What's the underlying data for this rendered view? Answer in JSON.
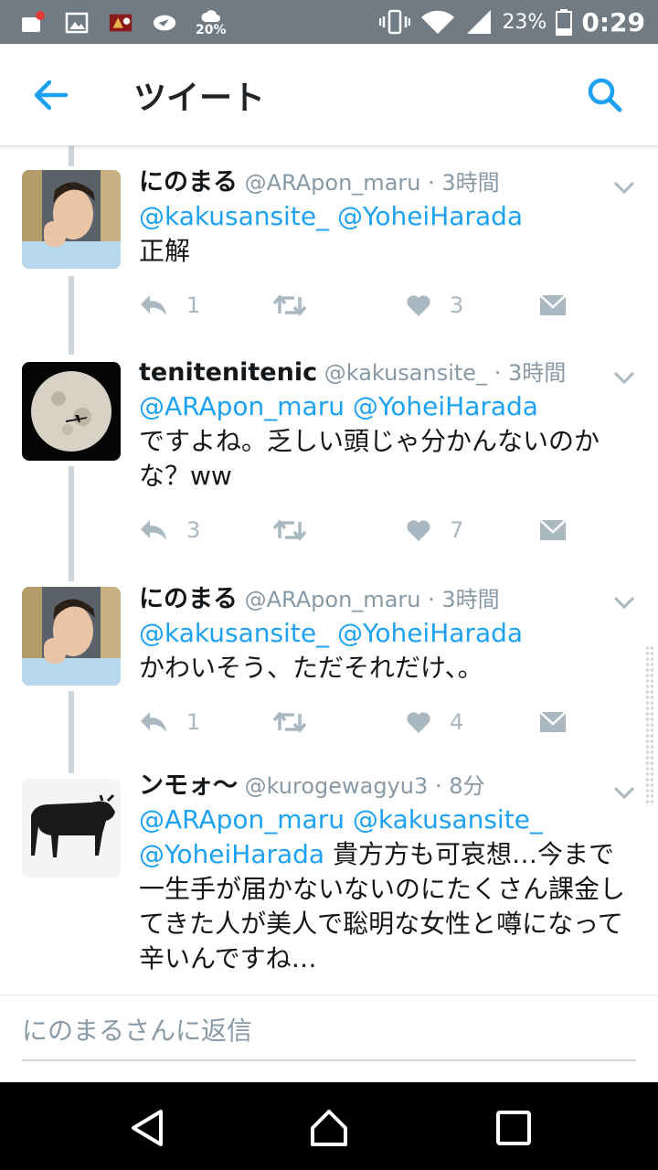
{
  "status_bar": {
    "weather_pct": "20%",
    "battery": "23%",
    "time": "0:29"
  },
  "app_bar": {
    "title": "ツイート"
  },
  "tweets": [
    {
      "name": "にのまる",
      "handle": "@ARApon_maru",
      "time": "· 3時間",
      "mentions": "@kakusansite_ @YoheiHarada",
      "text": "正解",
      "replies": "1",
      "likes": "3"
    },
    {
      "name": "tenitenitenic",
      "handle": "@kakusansite_",
      "time": "· 3時間",
      "mentions": "@ARApon_maru @YoheiHarada",
      "text": "ですよね。乏しい頭じゃ分かんないのかな？ww",
      "replies": "3",
      "likes": "7"
    },
    {
      "name": "にのまる",
      "handle": "@ARApon_maru",
      "time": "· 3時間",
      "mentions": "@kakusansite_ @YoheiHarada",
      "text": "かわいそう、ただそれだけ、。",
      "replies": "1",
      "likes": "4"
    },
    {
      "name": "ンモォ〜",
      "handle": "@kurogewagyu3",
      "time": "· 8分",
      "mentions": "@ARApon_maru @kakusansite_ @YoheiHarada",
      "text": "貴方方も可哀想…今まで一生手が届かないないのにたくさん課金してきた人が美人で聡明な女性と噂になって辛いんですね…"
    }
  ],
  "reply_bar": {
    "placeholder": "にのまるさんに返信"
  },
  "colors": {
    "accent": "#1da1f2",
    "icon_gray": "#aab8c2",
    "status_bar": "#707b84"
  }
}
